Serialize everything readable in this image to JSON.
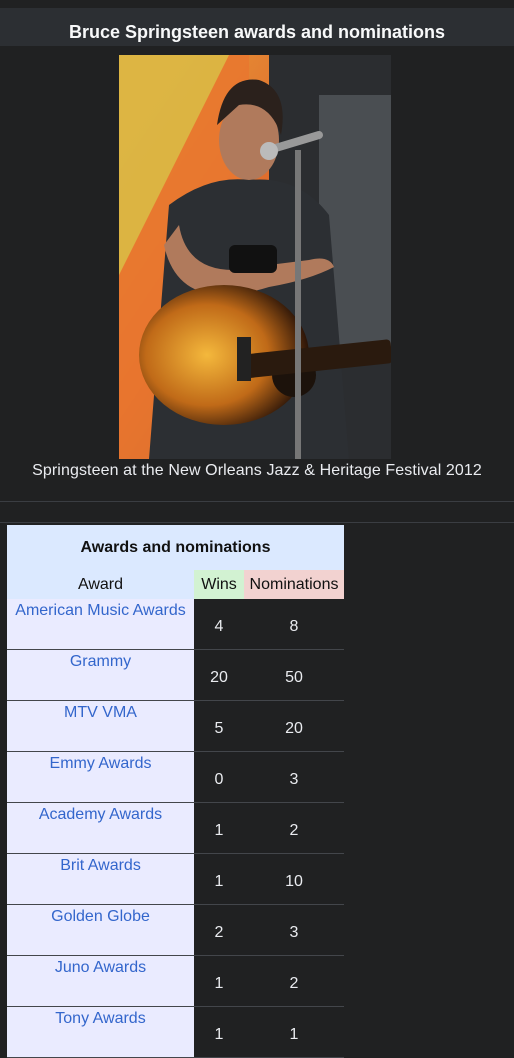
{
  "infobox": {
    "title": "Bruce Springsteen awards and nominations",
    "caption": "Springsteen at the New Orleans Jazz & Heritage Festival 2012"
  },
  "table": {
    "heading": "Awards and nominations",
    "columns": {
      "award": "Award",
      "wins": "Wins",
      "nominations": "Nominations"
    },
    "rows": [
      {
        "award": "American Music Awards",
        "wins": "4",
        "nominations": "8"
      },
      {
        "award": "Grammy",
        "wins": "20",
        "nominations": "50"
      },
      {
        "award": "MTV VMA",
        "wins": "5",
        "nominations": "20"
      },
      {
        "award": "Emmy Awards",
        "wins": "0",
        "nominations": "3"
      },
      {
        "award": "Academy Awards",
        "wins": "1",
        "nominations": "2"
      },
      {
        "award": "Brit Awards",
        "wins": "1",
        "nominations": "10"
      },
      {
        "award": "Golden Globe",
        "wins": "2",
        "nominations": "3"
      },
      {
        "award": "Juno Awards",
        "wins": "1",
        "nominations": "2"
      },
      {
        "award": "Tony Awards",
        "wins": "1",
        "nominations": "1"
      }
    ]
  }
}
